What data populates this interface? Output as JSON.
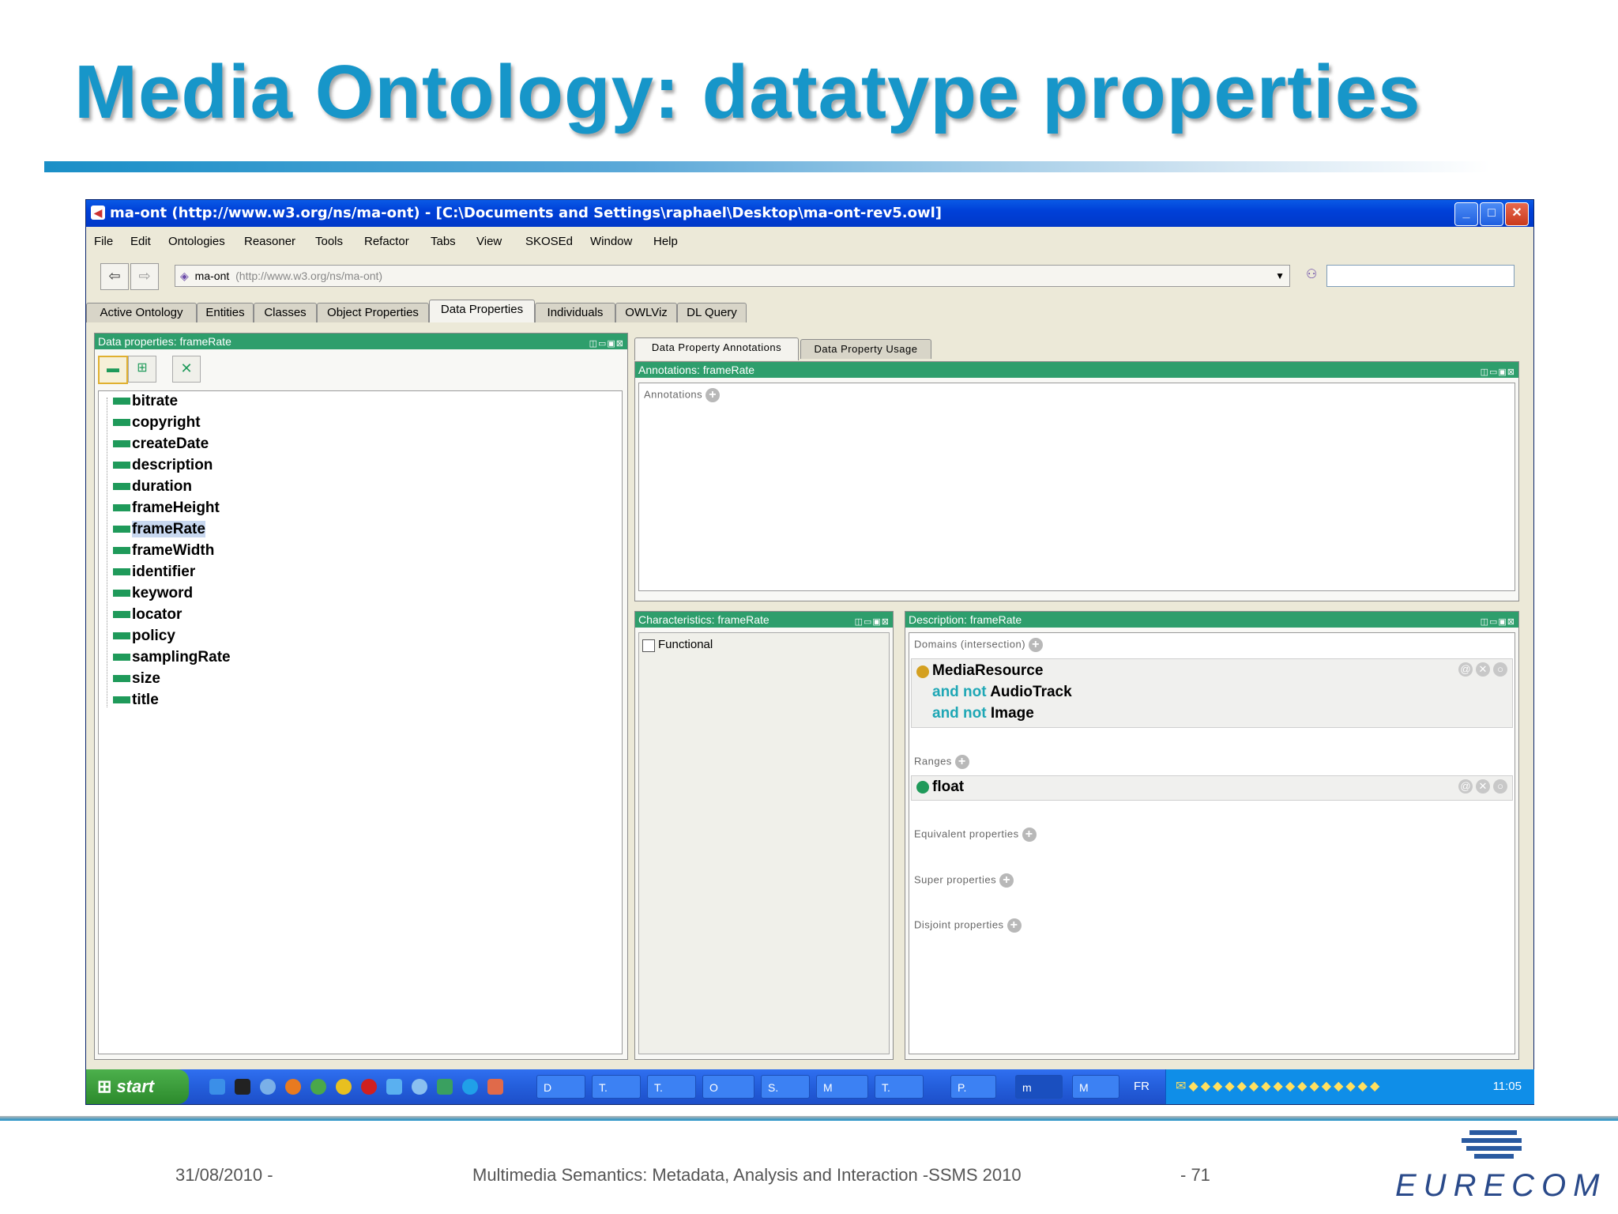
{
  "slide": {
    "title": "Media Ontology: datatype properties",
    "footer_date": "31/08/2010 -",
    "footer_center": "Multimedia Semantics: Metadata, Analysis and Interaction -SSMS 2010",
    "footer_page": "- 71",
    "logo_text": "EURECOM"
  },
  "window": {
    "title": "ma-ont (http://www.w3.org/ns/ma-ont) - [C:\\Documents and Settings\\raphael\\Desktop\\ma-ont-rev5.owl]"
  },
  "menu": [
    "File",
    "Edit",
    "Ontologies",
    "Reasoner",
    "Tools",
    "Refactor",
    "Tabs",
    "View",
    "SKOSEd",
    "Window",
    "Help"
  ],
  "toolbar": {
    "ontology_name": "ma-ont",
    "ontology_uri": "(http://www.w3.org/ns/ma-ont)",
    "search_value": ""
  },
  "tabs": [
    "Active Ontology",
    "Entities",
    "Classes",
    "Object Properties",
    "Data Properties",
    "Individuals",
    "OWLViz",
    "DL Query"
  ],
  "active_tab": "Data Properties",
  "left_panel": {
    "header": "Data properties: frameRate",
    "items": [
      "bitrate",
      "copyright",
      "createDate",
      "description",
      "duration",
      "frameHeight",
      "frameRate",
      "frameWidth",
      "identifier",
      "keyword",
      "locator",
      "policy",
      "samplingRate",
      "size",
      "title"
    ],
    "selected": "frameRate"
  },
  "right_tabs": [
    "Data Property Annotations",
    "Data Property Usage"
  ],
  "annotations_panel": {
    "header": "Annotations: frameRate",
    "label": "Annotations"
  },
  "characteristics_panel": {
    "header": "Characteristics: frameRate",
    "functional_label": "Functional",
    "functional_checked": false
  },
  "description_panel": {
    "header": "Description: frameRate",
    "domains_label": "Domains (intersection)",
    "domain_class": "MediaResource",
    "and_not_1": "and not",
    "domain_neg_1": "AudioTrack",
    "and_not_2": "and not",
    "domain_neg_2": "Image",
    "ranges_label": "Ranges",
    "range_type": "float",
    "equivalent_label": "Equivalent properties",
    "super_label": "Super properties",
    "disjoint_label": "Disjoint properties"
  },
  "taskbar": {
    "start_label": "start",
    "task_buttons": [
      "D",
      "T.",
      "T.",
      "O",
      "S.",
      "M",
      "T.",
      "P.",
      "m",
      "M"
    ],
    "lang": "FR",
    "clock": "11:05"
  },
  "colors": {
    "title_blue": "#1796c9",
    "panel_header_green": "#2e9e6c",
    "keyword_teal": "#1ea7b5",
    "xp_blue": "#245edb"
  }
}
